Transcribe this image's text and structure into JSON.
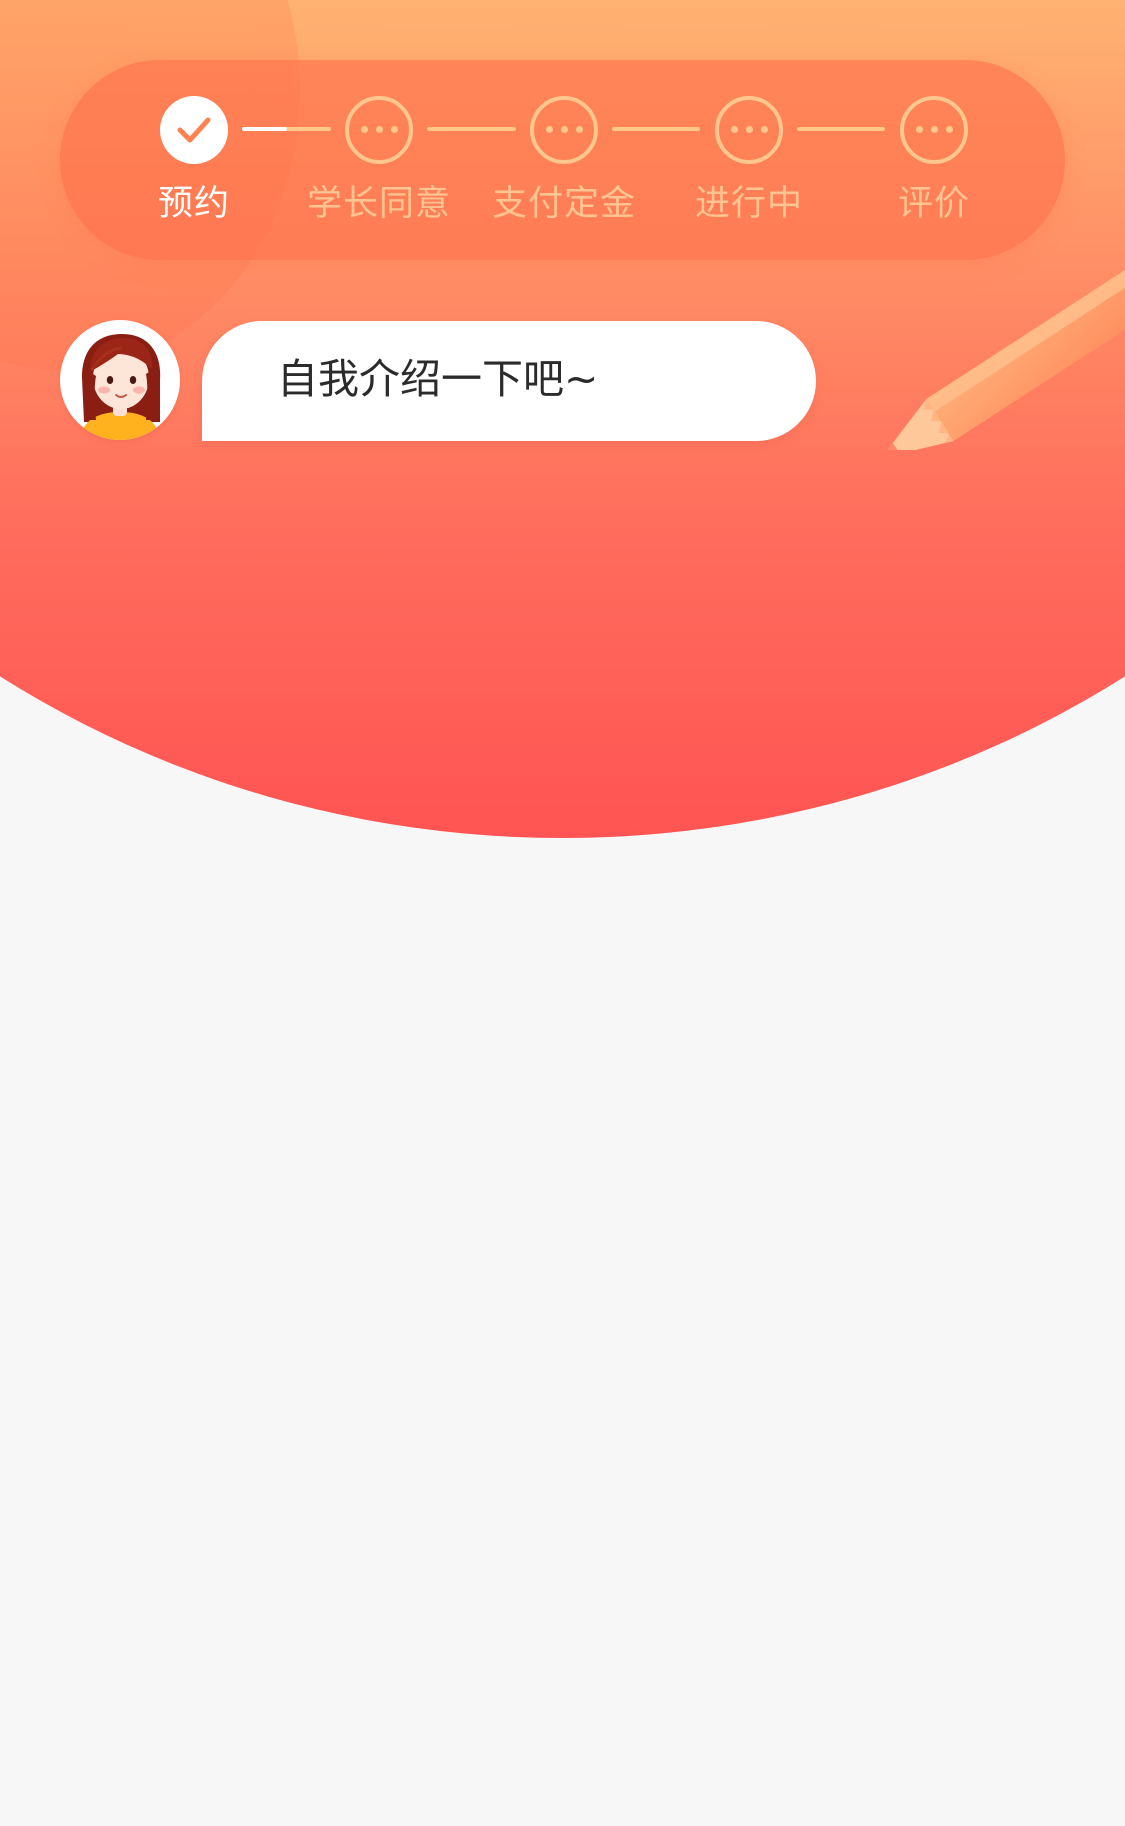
{
  "steps": [
    {
      "label": "预约",
      "status": "done",
      "icon": "check-icon"
    },
    {
      "label": "学长同意",
      "status": "pending",
      "icon": "more-dots-icon"
    },
    {
      "label": "支付定金",
      "status": "pending",
      "icon": "more-dots-icon"
    },
    {
      "label": "进行中",
      "status": "pending",
      "icon": "more-dots-icon"
    },
    {
      "label": "评价",
      "status": "pending",
      "icon": "more-dots-icon"
    }
  ],
  "chat": {
    "message": "自我介绍一下吧~",
    "avatar_icon": "girl-avatar-icon"
  },
  "decoration": {
    "pencil_icon": "pencil-icon"
  },
  "colors": {
    "header_top": "#ffc27c",
    "header_bottom": "#ff5453",
    "panel": "#ff8a5c",
    "step_done": "#ffffff",
    "step_pending": "#ffc78e",
    "check_mark": "#ff8150",
    "page_background": "#f7f7f7",
    "message_text": "#2b2b2b"
  }
}
